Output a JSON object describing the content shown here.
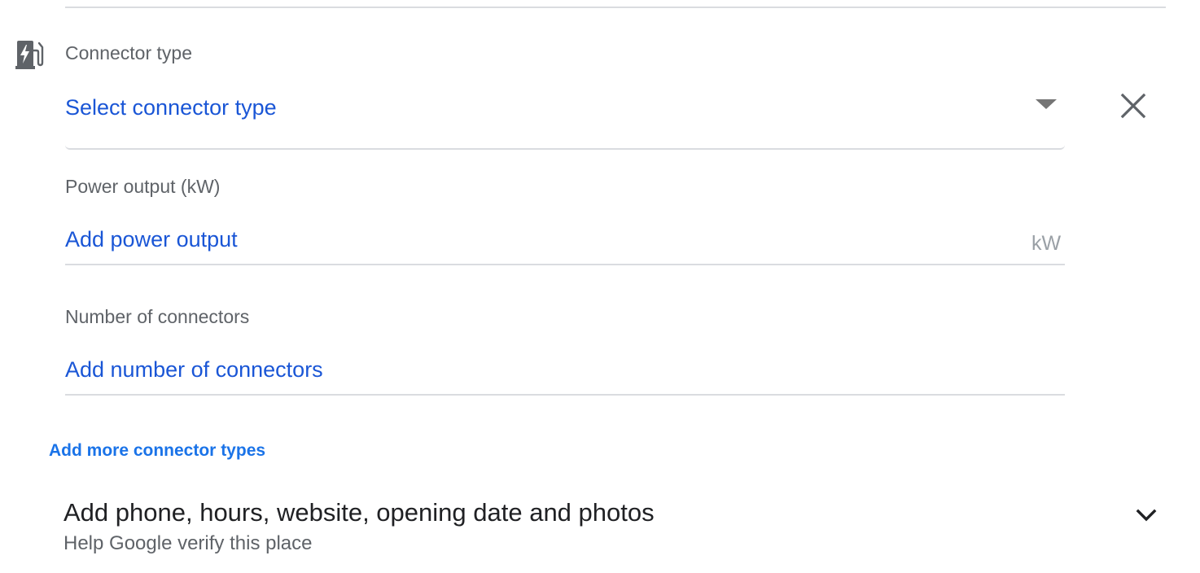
{
  "connector": {
    "icon": "ev-station-icon",
    "label": "Connector type",
    "select_value": "Select connector type",
    "dropdown_icon": "dropdown-arrow-icon",
    "close_icon": "close-icon"
  },
  "power_output": {
    "label": "Power output (kW)",
    "value": "Add power output",
    "unit": "kW"
  },
  "connector_count": {
    "label": "Number of connectors",
    "value": "Add number of connectors"
  },
  "add_more": {
    "label": "Add more connector types"
  },
  "extra_details": {
    "title": "Add phone, hours, website, opening date and photos",
    "subtitle": "Help Google verify this place",
    "icon": "chevron-down-icon"
  },
  "colors": {
    "link_blue": "#1a73e8",
    "value_blue": "#1a56d6",
    "label_gray": "#5f6368",
    "divider": "#dadce0"
  }
}
